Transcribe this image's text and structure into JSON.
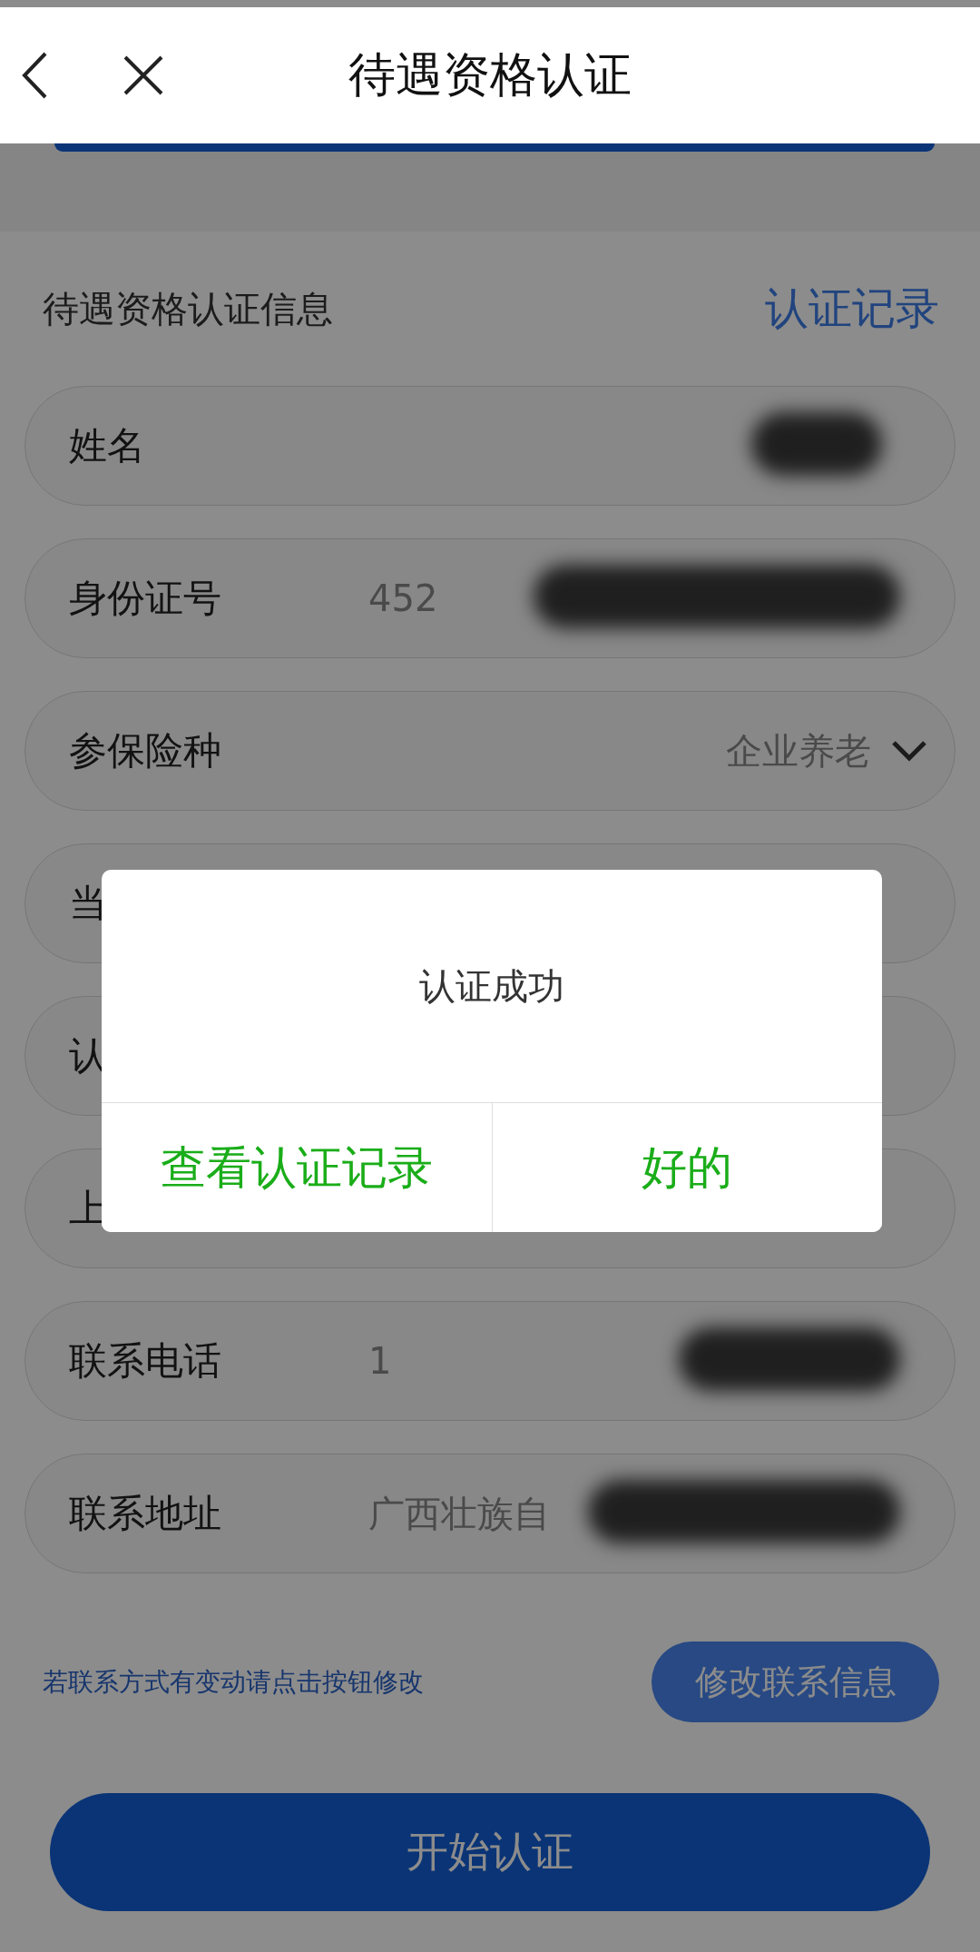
{
  "header": {
    "title": "待遇资格认证"
  },
  "section": {
    "title": "待遇资格认证信息",
    "link": "认证记录"
  },
  "fields": [
    {
      "label": "姓名",
      "kind": "redacted"
    },
    {
      "label": "身份证号",
      "value": "452",
      "kind": "redacted"
    },
    {
      "label": "参保险种",
      "value": "企业养老",
      "kind": "select"
    },
    {
      "label": "当",
      "kind": "plain"
    },
    {
      "label": "认",
      "kind": "plain"
    },
    {
      "label": "上",
      "kind": "plain"
    },
    {
      "label": "联系电话",
      "value": "1",
      "kind": "redacted"
    },
    {
      "label": "联系地址",
      "value": "广西壮族自",
      "kind": "redacted"
    }
  ],
  "hint": "若联系方式有变动请点击按钮修改",
  "edit_button": "修改联系信息",
  "start_button": "开始认证",
  "dialog": {
    "message": "认证成功",
    "buttons": [
      "查看认证记录",
      "好的"
    ]
  }
}
